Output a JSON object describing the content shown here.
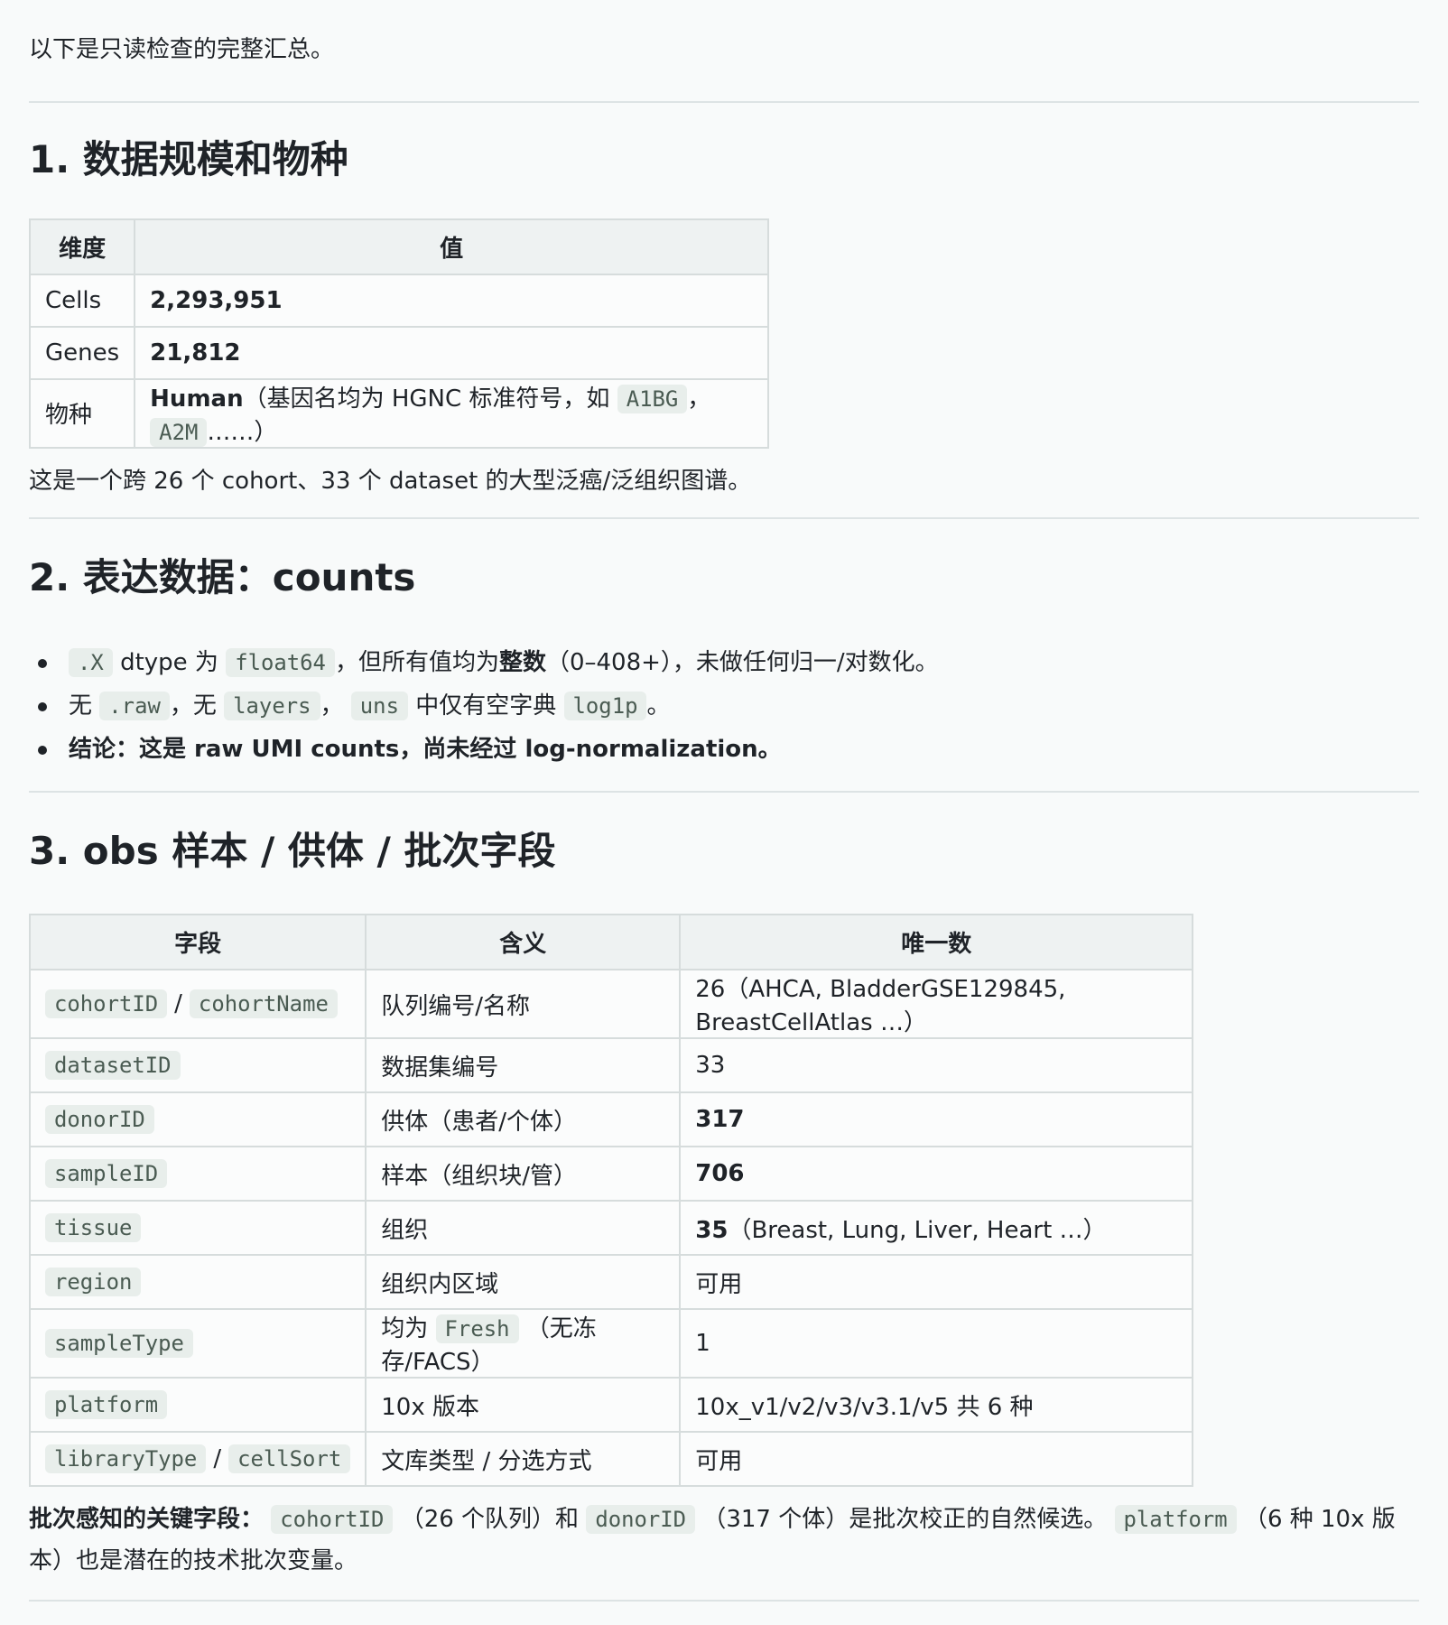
{
  "intro": "以下是只读检查的完整汇总。",
  "section1": {
    "title": "1. 数据规模和物种",
    "headers": [
      "维度",
      "值"
    ],
    "rows": [
      {
        "dim": "Cells",
        "value": "2,293,951"
      },
      {
        "dim": "Genes",
        "value": "21,812"
      },
      {
        "dim": "物种",
        "value": "Human",
        "note_pre": "（基因名均为 HGNC 标准符号，如",
        "code1": "A1BG",
        "sep": "，",
        "code2": "A2M",
        "note_post": "……）"
      }
    ],
    "summary": "这是一个跨 26 个 cohort、33 个 dataset 的大型泛癌/泛组织图谱。"
  },
  "section2": {
    "title": "2. 表达数据：counts",
    "bullet1": {
      "code1": ".X",
      "t1": "dtype 为",
      "code2": "float64",
      "t2": "，但所有值均为",
      "bold": "整数",
      "t3": "（0–408+），未做任何归一/对数化。"
    },
    "bullet2": {
      "t1": "无",
      "code1": ".raw",
      "t2": "，无",
      "code2": "layers",
      "t3": "，",
      "code3": "uns",
      "t4": "中仅有空字典",
      "code4": "log1p",
      "t5": "。"
    },
    "bullet3": "结论：这是 raw UMI counts，尚未经过 log-normalization。"
  },
  "section3": {
    "title": "3. obs 样本 / 供体 / 批次字段",
    "headers": [
      "字段",
      "含义",
      "唯一数"
    ],
    "rows": [
      {
        "field1": "cohortID",
        "sep": "/",
        "field2": "cohortName",
        "meaning": "队列编号/名称",
        "count": "26",
        "count_note": "（AHCA, BladderGSE129845, BreastCellAtlas …）"
      },
      {
        "field1": "datasetID",
        "meaning": "数据集编号",
        "count": "33"
      },
      {
        "field1": "donorID",
        "meaning": "供体（患者/个体）",
        "count": "317"
      },
      {
        "field1": "sampleID",
        "meaning": "样本（组织块/管）",
        "count": "706"
      },
      {
        "field1": "tissue",
        "meaning": "组织",
        "count": "35",
        "count_note": "（Breast, Lung, Liver, Heart …）"
      },
      {
        "field1": "region",
        "meaning": "组织内区域",
        "count": "可用"
      },
      {
        "field1": "sampleType",
        "meaning_pre": "均为",
        "meaning_code": "Fresh",
        "meaning_post": "（无冻存/FACS）",
        "count": "1"
      },
      {
        "field1": "platform",
        "meaning": "10x 版本",
        "count": "10x_v1/v2/v3/v3.1/v5 共 6 种"
      },
      {
        "field1": "libraryType",
        "sep": "/",
        "field2": "cellSort",
        "meaning": "文库类型 / 分选方式",
        "count": "可用"
      }
    ],
    "note": {
      "bold": "批次感知的关键字段：",
      "code1": "cohortID",
      "t1": "（26 个队列）和",
      "code2": "donorID",
      "t2": "（317 个体）是批次校正的自然候选。",
      "code3": "platform",
      "t3": "（6 种 10x 版本）也是潜在的技术批次变量。"
    }
  }
}
